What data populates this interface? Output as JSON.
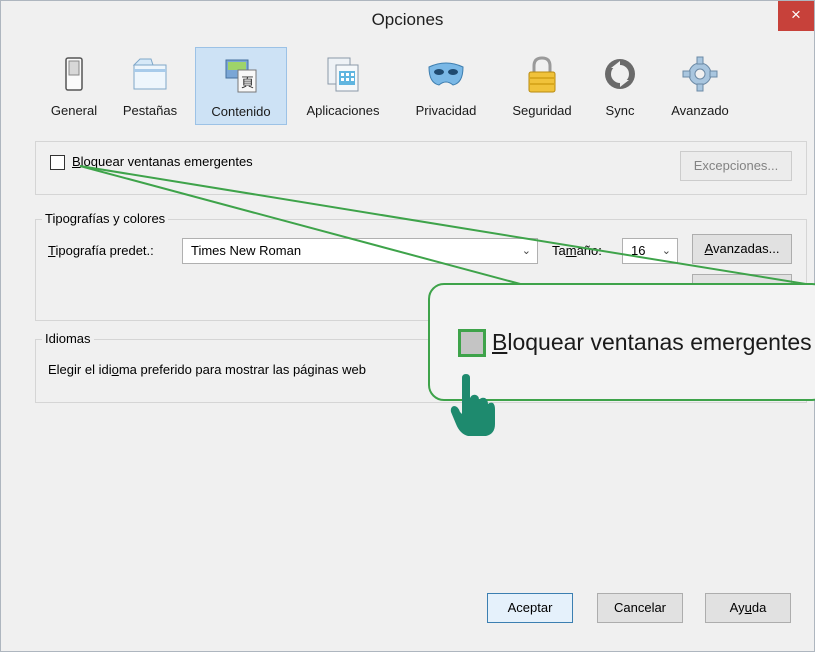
{
  "window": {
    "title": "Opciones",
    "close_label": "×"
  },
  "toolbar": {
    "items": [
      {
        "label": "General",
        "icon": "general-switch-icon"
      },
      {
        "label": "Pestañas",
        "icon": "tabs-icon"
      },
      {
        "label": "Contenido",
        "icon": "content-icon",
        "selected": true
      },
      {
        "label": "Aplicaciones",
        "icon": "applications-icon"
      },
      {
        "label": "Privacidad",
        "icon": "privacy-mask-icon"
      },
      {
        "label": "Seguridad",
        "icon": "security-lock-icon"
      },
      {
        "label": "Sync",
        "icon": "sync-icon"
      },
      {
        "label": "Avanzado",
        "icon": "advanced-gear-icon"
      }
    ]
  },
  "popups": {
    "block_label_first": "B",
    "block_label_rest": "loquear ventanas emergentes",
    "block_checked": false,
    "exceptions_label": "Excepciones..."
  },
  "fonts": {
    "group_title": "Tipografías y colores",
    "default_font_label_first": "T",
    "default_font_label_rest": "ipografía predet.:",
    "default_font_value": "Times New Roman",
    "size_label_a": "Ta",
    "size_label_u": "m",
    "size_label_b": "año:",
    "size_value": "16",
    "advanced_label_first": "A",
    "advanced_label_rest": "vanzadas..."
  },
  "languages": {
    "group_title": "Idiomas",
    "desc_a": "Elegir el idi",
    "desc_u": "o",
    "desc_b": "ma preferido para mostrar las páginas web"
  },
  "footer": {
    "ok_label": "Aceptar",
    "cancel_label": "Cancelar",
    "help_a": "Ay",
    "help_u": "u",
    "help_b": "da"
  },
  "zoom": {
    "label_first": "B",
    "label_rest": "loquear ventanas emergentes"
  },
  "colors": {
    "accent_green": "#3ea34a",
    "hand_teal": "#1e8a6e",
    "close_red": "#c7413a",
    "selected_tab": "#cde2f5"
  }
}
